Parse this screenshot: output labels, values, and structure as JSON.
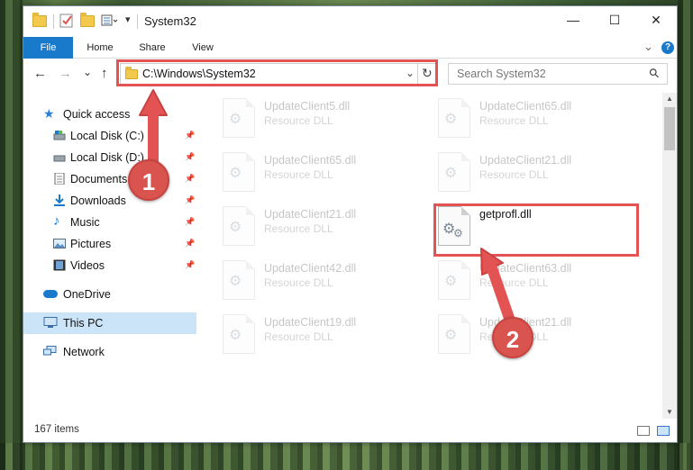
{
  "window": {
    "title": "System32",
    "minimize": "—",
    "maximize": "☐",
    "close": "✕"
  },
  "ribbon": {
    "tabs": [
      "File",
      "Home",
      "Share",
      "View"
    ],
    "help": "?",
    "expand": "⌄"
  },
  "nav": {
    "back": "←",
    "forward": "→",
    "recent": "⌄",
    "up": "↑",
    "address": "C:\\Windows\\System32",
    "addr_dropdown": "⌄",
    "refresh": "↻",
    "search_placeholder": "Search System32",
    "search_icon": "⚲"
  },
  "sidebar": {
    "quick_access": "Quick access",
    "items": [
      {
        "label": "Local Disk (C:)",
        "icon": "drive-icon"
      },
      {
        "label": "Local Disk (D:)",
        "icon": "drive-icon"
      },
      {
        "label": "Documents",
        "icon": "documents-icon"
      },
      {
        "label": "Downloads",
        "icon": "download-icon"
      },
      {
        "label": "Music",
        "icon": "music-icon"
      },
      {
        "label": "Pictures",
        "icon": "pictures-icon"
      },
      {
        "label": "Videos",
        "icon": "videos-icon"
      }
    ],
    "pin": "📌",
    "onedrive": "OneDrive",
    "thispc": "This PC",
    "network": "Network"
  },
  "files": [
    {
      "name": "UpdateClient5.dll",
      "sub": "Resource DLL"
    },
    {
      "name": "UpdateClient65.dll",
      "sub": "Resource DLL"
    },
    {
      "name": "UpdateClient65.dll",
      "sub": "Resource DLL"
    },
    {
      "name": "UpdateClient21.dll",
      "sub": "Resource DLL"
    },
    {
      "name": "UpdateClient21.dll",
      "sub": "Resource DLL"
    },
    {
      "name": "getprofl.dll",
      "sub": ""
    },
    {
      "name": "UpdateClient42.dll",
      "sub": "Resource DLL"
    },
    {
      "name": "UpdateClient63.dll",
      "sub": "Resource DLL"
    },
    {
      "name": "UpdateClient19.dll",
      "sub": "Resource DLL"
    },
    {
      "name": "UpdateClient21.dll",
      "sub": "Resource DLL"
    }
  ],
  "status": {
    "count": "167 items"
  },
  "annotations": {
    "step1": "1",
    "step2": "2",
    "color": "#e35353"
  }
}
